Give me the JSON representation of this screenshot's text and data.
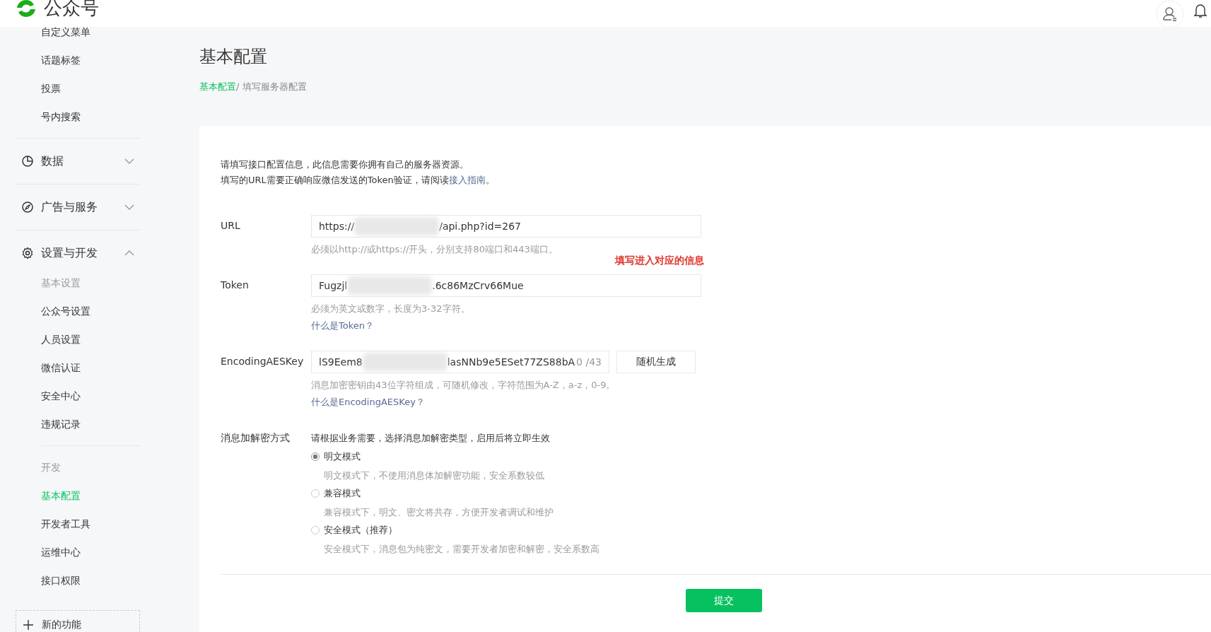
{
  "header": {
    "logo_text": "公众号"
  },
  "sidebar": {
    "top_items": [
      {
        "label": "自定义菜单",
        "selected": false
      },
      {
        "label": "话题标签",
        "selected": false
      },
      {
        "label": "投票",
        "selected": false
      },
      {
        "label": "号内搜索",
        "selected": false
      }
    ],
    "sections": [
      {
        "label": "数据",
        "kind": "chart",
        "expanded": false
      },
      {
        "label": "广告与服务",
        "kind": "compass",
        "expanded": false
      },
      {
        "label": "设置与开发",
        "kind": "gear",
        "expanded": true,
        "groups": [
          {
            "heading": "基本设置",
            "items": [
              {
                "label": "公众号设置",
                "selected": false
              },
              {
                "label": "人员设置",
                "selected": false
              },
              {
                "label": "微信认证",
                "selected": false
              },
              {
                "label": "安全中心",
                "selected": false
              },
              {
                "label": "违规记录",
                "selected": false
              }
            ]
          },
          {
            "heading": "开发",
            "items": [
              {
                "label": "基本配置",
                "selected": true
              },
              {
                "label": "开发者工具",
                "selected": false
              },
              {
                "label": "运维中心",
                "selected": false
              },
              {
                "label": "接口权限",
                "selected": false
              }
            ]
          }
        ]
      }
    ],
    "new_feature": "新的功能"
  },
  "page": {
    "title": "基本配置",
    "breadcrumb": [
      {
        "label": "基本配置",
        "kind": "link"
      },
      {
        "label": "/ 填写服务器配置",
        "kind": "current"
      }
    ]
  },
  "intro": {
    "line1": "请填写接口配置信息，此信息需要你拥有自己的服务器资源。",
    "line2_before": "填写的URL需要正确响应微信发送的Token验证，请阅读",
    "line2_link": "接入指南",
    "line2_after": "。"
  },
  "annotation": "填写进入对应的信息",
  "fields": [
    {
      "label": "URL",
      "value_start": "https://",
      "value_end": "/api.php?id=267",
      "hint": "必须以http://或https://开头，分别支持80端口和443端口。"
    },
    {
      "label": "Token",
      "value_start": "Fugzjl",
      "value_end": ".6c86MzCrv66Mue",
      "hint": "必须为英文或数字，长度为3-32字符。",
      "link": "什么是Token？"
    },
    {
      "label": "EncodingAESKey",
      "value_start": "lS9Eem8",
      "value_end": "lasNNb9e5ESet77ZS88bA",
      "counter": "0 /43",
      "button": "随机生成",
      "hint": "消息加密密钥由43位字符组成，可随机修改，字符范围为A-Z，a-z，0-9。",
      "link": "什么是EncodingAESKey？"
    }
  ],
  "encryption": {
    "label": "消息加解密方式",
    "prompt": "请根据业务需要，选择消息加解密类型，启用后将立即生效",
    "options": [
      {
        "label": "明文模式",
        "desc": "明文模式下，不使用消息体加解密功能，安全系数较低",
        "selected": true
      },
      {
        "label": "兼容模式",
        "desc": "兼容模式下，明文、密文将共存，方便开发者调试和维护",
        "selected": false
      },
      {
        "label": "安全模式（推荐）",
        "desc": "安全模式下，消息包为纯密文，需要开发者加密和解密，安全系数高",
        "selected": false
      }
    ]
  },
  "submit": "提交"
}
